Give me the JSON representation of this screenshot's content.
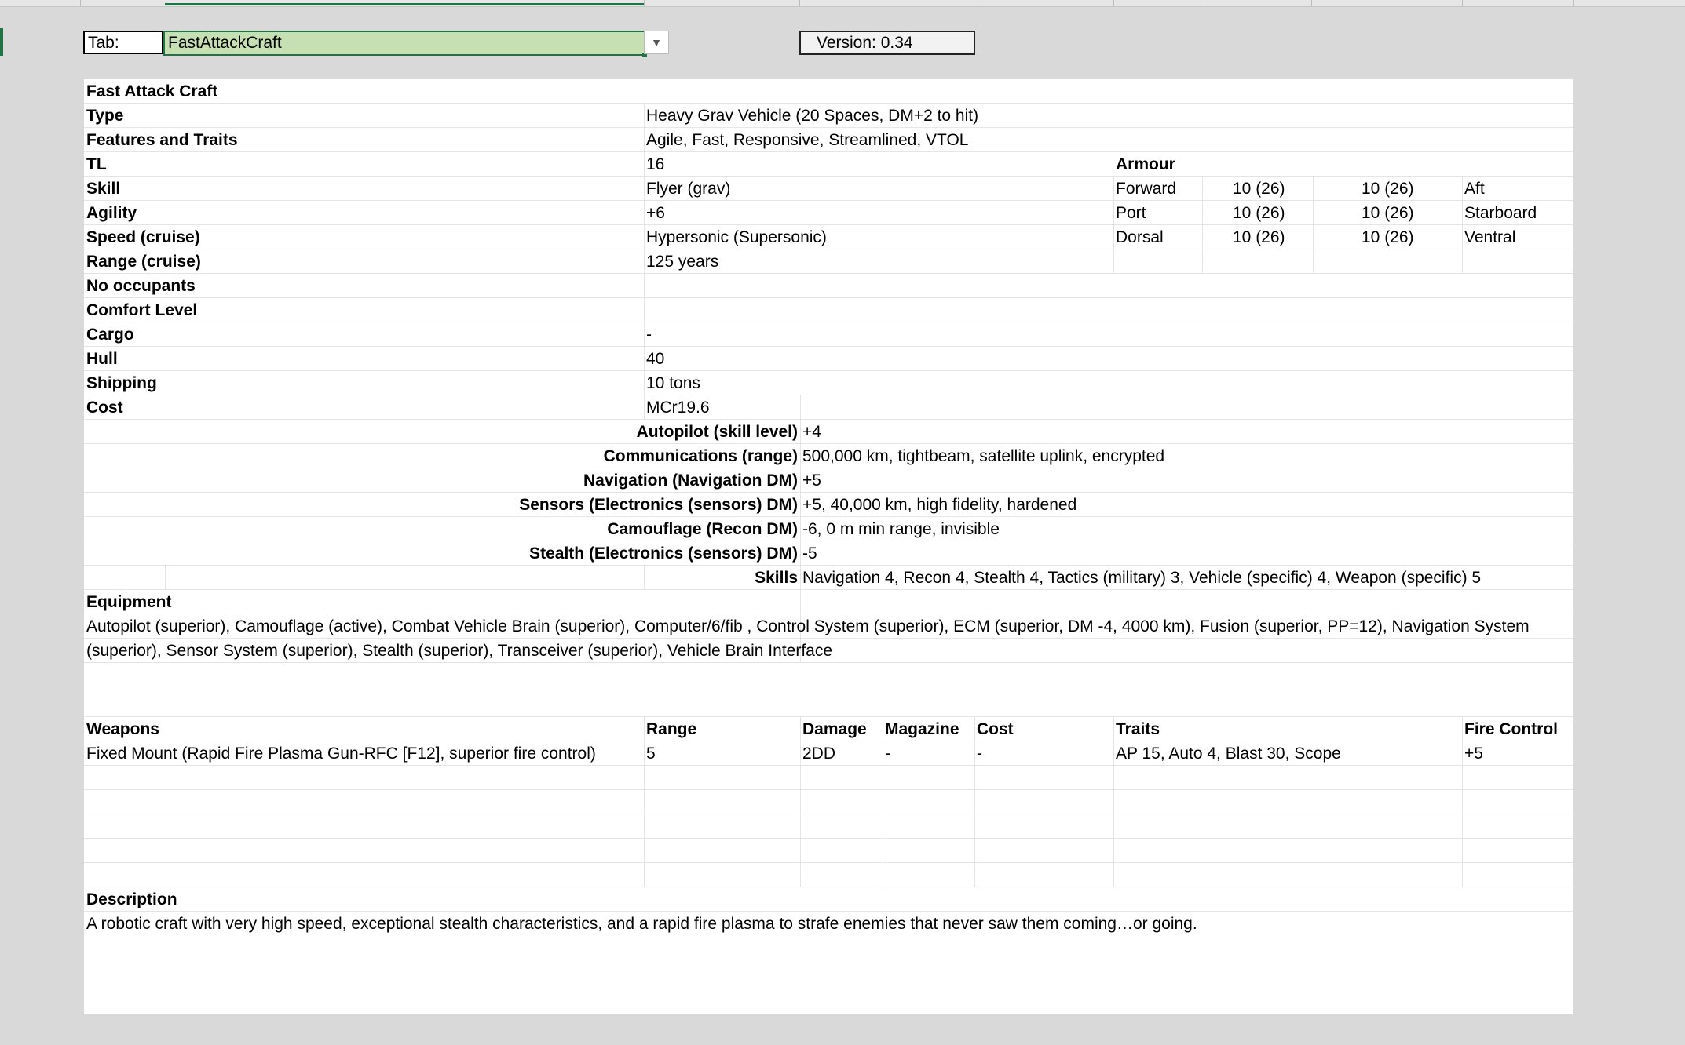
{
  "toolbar": {
    "tab_label": "Tab:",
    "tab_value": "FastAttackCraft",
    "version": "Version: 0.34"
  },
  "craft": {
    "title": "Fast Attack Craft",
    "stats": [
      {
        "label": "Type",
        "value": "Heavy Grav Vehicle (20 Spaces, DM+2 to hit)"
      },
      {
        "label": "Features and Traits",
        "value": "Agile, Fast, Responsive, Streamlined, VTOL"
      },
      {
        "label": "TL",
        "value": "16"
      },
      {
        "label": "Skill",
        "value": "Flyer (grav)"
      },
      {
        "label": "Agility",
        "value": "+6"
      },
      {
        "label": "Speed (cruise)",
        "value": "Hypersonic (Supersonic)"
      },
      {
        "label": "Range (cruise)",
        "value": "125 years"
      },
      {
        "label": "No occupants",
        "value": ""
      },
      {
        "label": "Comfort Level",
        "value": ""
      },
      {
        "label": "Cargo",
        "value": "-"
      },
      {
        "label": "Hull",
        "value": "40"
      },
      {
        "label": "Shipping",
        "value": "10 tons"
      },
      {
        "label": "Cost",
        "value": "MCr19.6"
      }
    ],
    "armour": {
      "title": "Armour",
      "rows": [
        {
          "left": "Forward",
          "v1": "10 (26)",
          "v2": "10 (26)",
          "right": "Aft"
        },
        {
          "left": "Port",
          "v1": "10 (26)",
          "v2": "10 (26)",
          "right": "Starboard"
        },
        {
          "left": "Dorsal",
          "v1": "10 (26)",
          "v2": "10 (26)",
          "right": "Ventral"
        }
      ]
    },
    "systems": [
      {
        "label": "Autopilot (skill level)",
        "value": "+4"
      },
      {
        "label": "Communications (range)",
        "value": "500,000 km, tightbeam, satellite uplink, encrypted"
      },
      {
        "label": "Navigation (Navigation DM)",
        "value": "+5"
      },
      {
        "label": "Sensors (Electronics (sensors) DM)",
        "value": "+5, 40,000 km, high fidelity, hardened"
      },
      {
        "label": "Camouflage (Recon DM)",
        "value": "-6, 0 m min range, invisible"
      },
      {
        "label": "Stealth (Electronics (sensors) DM)",
        "value": "-5"
      },
      {
        "label": "Skills",
        "value": "Navigation 4, Recon 4, Stealth 4, Tactics (military) 3, Vehicle (specific) 4, Weapon (specific) 5"
      }
    ],
    "equipment": {
      "title": "Equipment",
      "text": "Autopilot (superior), Camouflage (active), Combat Vehicle Brain (superior), Computer/6/fib , Control System (superior), ECM (superior, DM -4, 4000 km), Fusion (superior, PP=12), Navigation System (superior), Sensor System (superior), Stealth (superior), Transceiver (superior), Vehicle Brain Interface"
    },
    "weapons": {
      "headers": [
        "Weapons",
        "Range",
        "Damage",
        "Magazine",
        "Cost",
        "Traits",
        "Fire Control"
      ],
      "rows": [
        [
          "Fixed Mount (Rapid Fire Plasma Gun-RFC [F12], superior fire control)",
          "5",
          "2DD",
          "-",
          "-",
          "AP 15, Auto 4, Blast 30, Scope",
          "+5"
        ]
      ]
    },
    "description": {
      "title": "Description",
      "text": "A robotic craft with very high speed, exceptional stealth characteristics, and a rapid fire plasma to strafe enemies that never saw them coming…or going."
    }
  }
}
